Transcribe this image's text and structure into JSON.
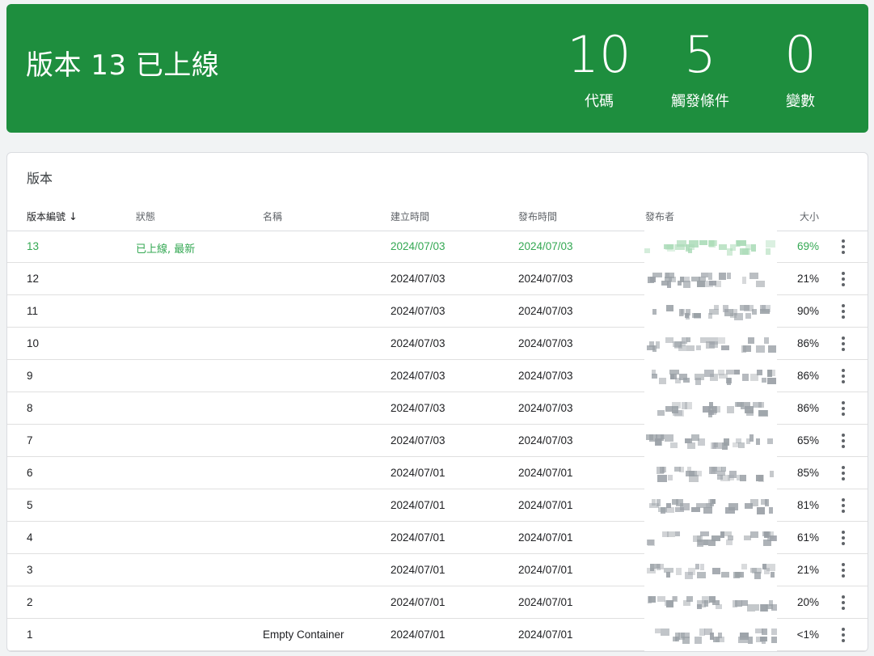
{
  "banner": {
    "title": "版本 13 已上線",
    "stats": [
      {
        "value": "10",
        "label": "代碼"
      },
      {
        "value": "5",
        "label": "觸發條件"
      },
      {
        "value": "0",
        "label": "變數"
      }
    ]
  },
  "table": {
    "title": "版本",
    "headers": {
      "number": "版本編號",
      "sort_icon": "arrow-down-icon",
      "status": "狀態",
      "name": "名稱",
      "created": "建立時間",
      "published": "發布時間",
      "publisher": "發布者",
      "size": "大小"
    },
    "rows": [
      {
        "number": "13",
        "status": "已上線, 最新",
        "name": "",
        "created": "2024/07/03",
        "published": "2024/07/03",
        "size": "69%",
        "live": true
      },
      {
        "number": "12",
        "status": "",
        "name": "",
        "created": "2024/07/03",
        "published": "2024/07/03",
        "size": "21%"
      },
      {
        "number": "11",
        "status": "",
        "name": "",
        "created": "2024/07/03",
        "published": "2024/07/03",
        "size": "90%"
      },
      {
        "number": "10",
        "status": "",
        "name": "",
        "created": "2024/07/03",
        "published": "2024/07/03",
        "size": "86%"
      },
      {
        "number": "9",
        "status": "",
        "name": "",
        "created": "2024/07/03",
        "published": "2024/07/03",
        "size": "86%"
      },
      {
        "number": "8",
        "status": "",
        "name": "",
        "created": "2024/07/03",
        "published": "2024/07/03",
        "size": "86%"
      },
      {
        "number": "7",
        "status": "",
        "name": "",
        "created": "2024/07/03",
        "published": "2024/07/03",
        "size": "65%"
      },
      {
        "number": "6",
        "status": "",
        "name": "",
        "created": "2024/07/01",
        "published": "2024/07/01",
        "size": "85%"
      },
      {
        "number": "5",
        "status": "",
        "name": "",
        "created": "2024/07/01",
        "published": "2024/07/01",
        "size": "81%"
      },
      {
        "number": "4",
        "status": "",
        "name": "",
        "created": "2024/07/01",
        "published": "2024/07/01",
        "size": "61%"
      },
      {
        "number": "3",
        "status": "",
        "name": "",
        "created": "2024/07/01",
        "published": "2024/07/01",
        "size": "21%"
      },
      {
        "number": "2",
        "status": "",
        "name": "",
        "created": "2024/07/01",
        "published": "2024/07/01",
        "size": "20%"
      },
      {
        "number": "1",
        "status": "",
        "name": "Empty Container",
        "created": "2024/07/01",
        "published": "2024/07/01",
        "size": "<1%"
      }
    ],
    "row_menu_icon": "more-vert-icon"
  },
  "colors": {
    "banner_bg": "#1e8e3e",
    "live_text": "#34a853",
    "live_pixel": "#a8dab5",
    "redacted_pixel": "#9aa0a6"
  }
}
